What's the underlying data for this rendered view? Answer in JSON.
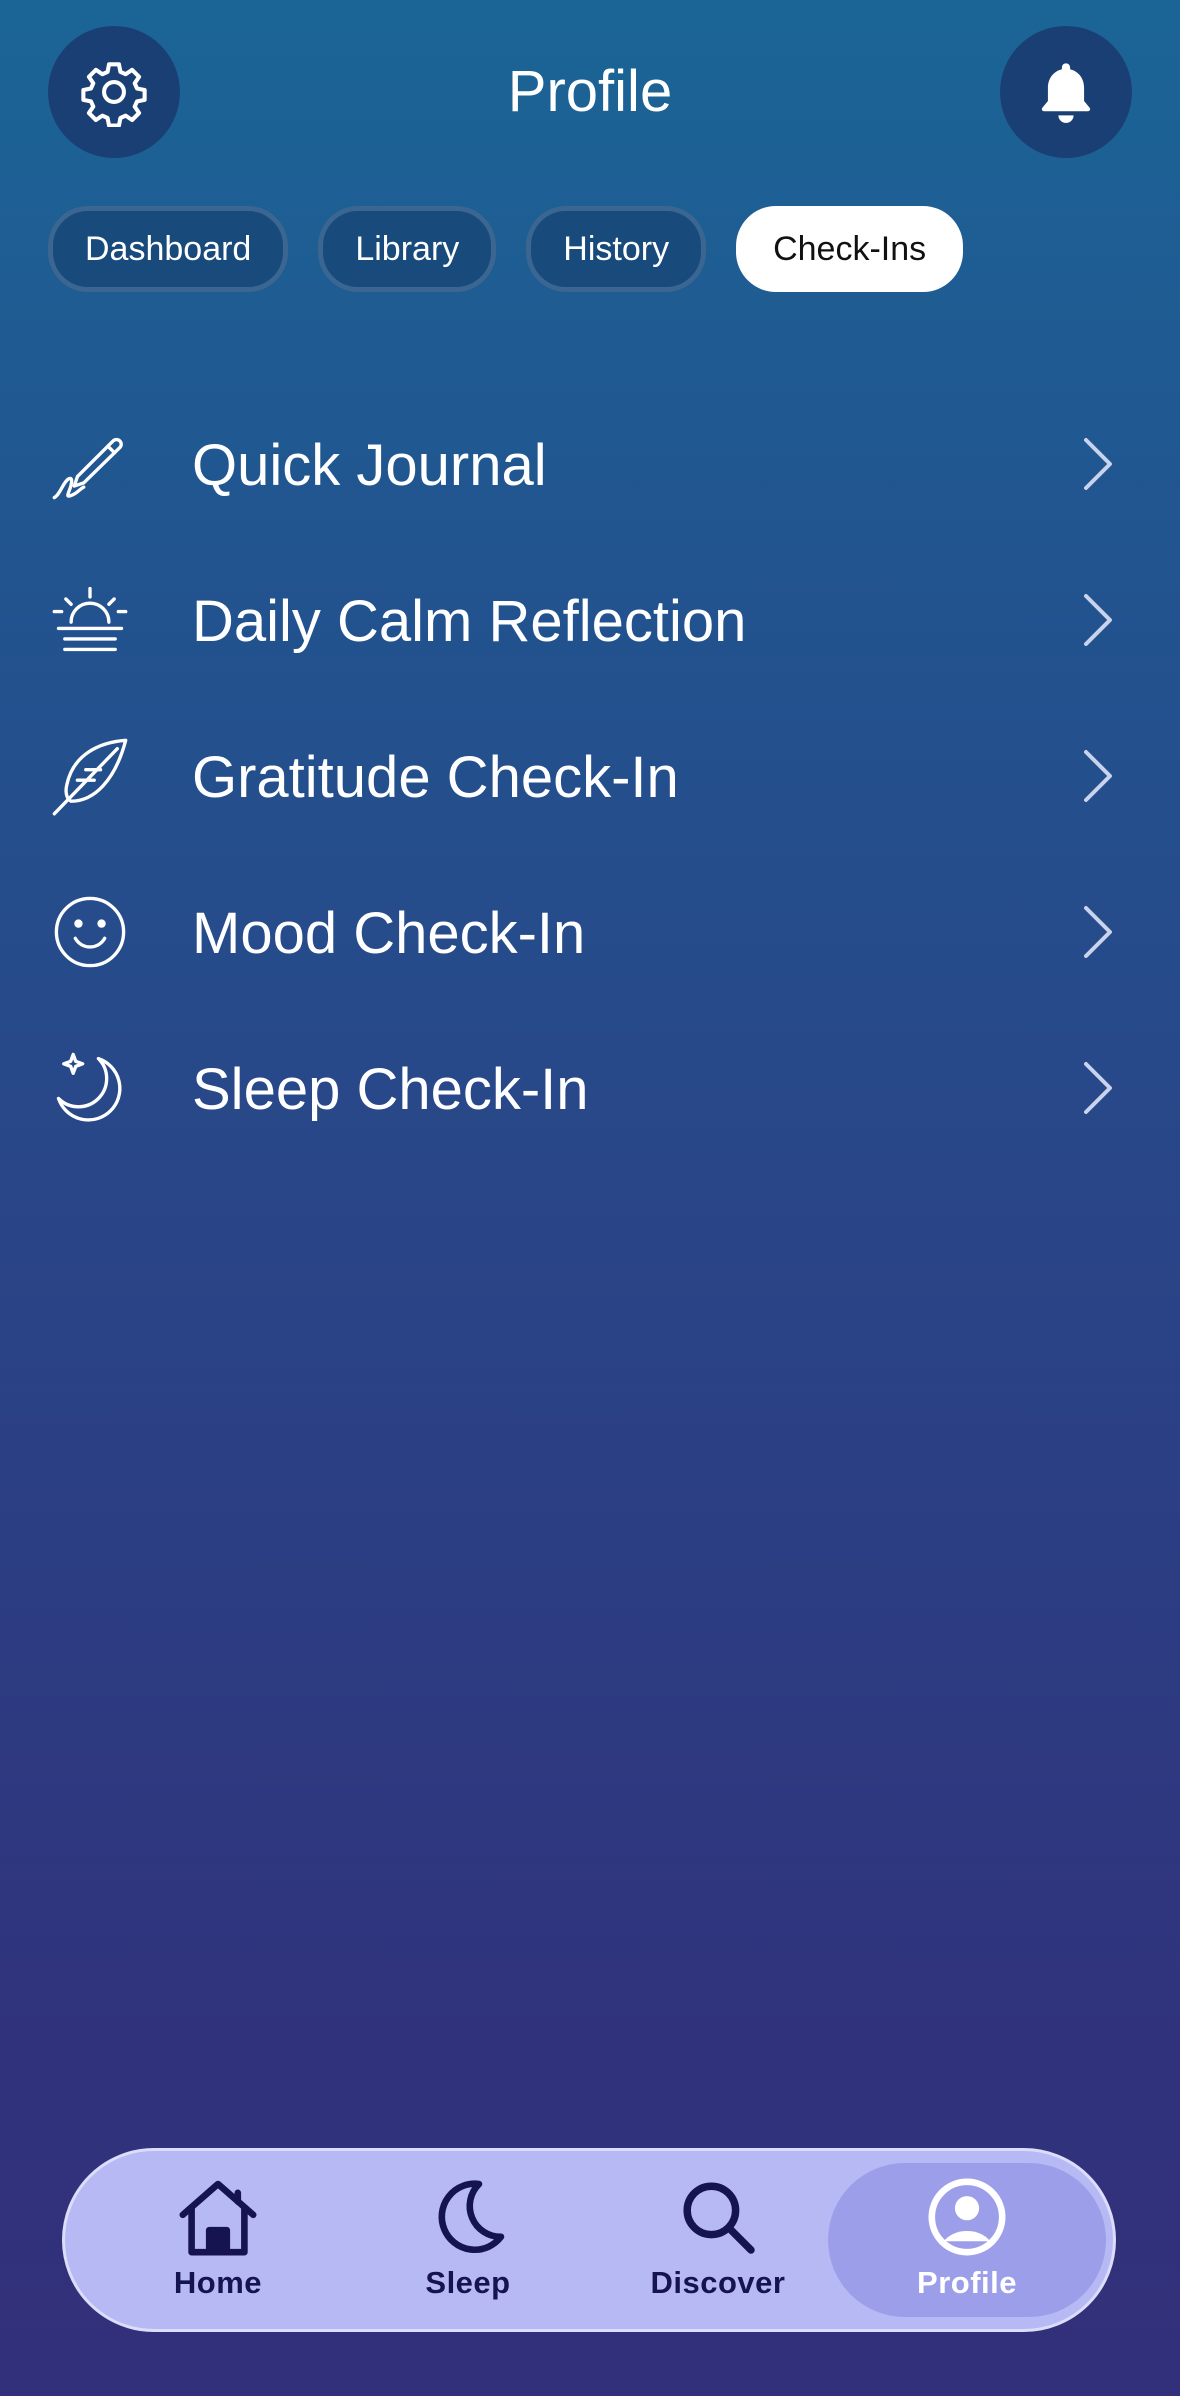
{
  "header": {
    "title": "Profile",
    "left_icon": "gear-icon",
    "right_icon": "bell-icon"
  },
  "tabs": [
    {
      "label": "Dashboard",
      "active": false
    },
    {
      "label": "Library",
      "active": false
    },
    {
      "label": "History",
      "active": false
    },
    {
      "label": "Check-Ins",
      "active": true
    }
  ],
  "check_ins": [
    {
      "label": "Quick Journal",
      "icon": "pencil-icon"
    },
    {
      "label": "Daily Calm Reflection",
      "icon": "sunrise-icon"
    },
    {
      "label": "Gratitude Check-In",
      "icon": "feather-icon"
    },
    {
      "label": "Mood Check-In",
      "icon": "smiley-icon"
    },
    {
      "label": "Sleep Check-In",
      "icon": "moon-sparkle-icon"
    }
  ],
  "bottom_nav": [
    {
      "label": "Home",
      "icon": "home-icon",
      "active": false
    },
    {
      "label": "Sleep",
      "icon": "moon-icon",
      "active": false
    },
    {
      "label": "Discover",
      "icon": "search-icon",
      "active": false
    },
    {
      "label": "Profile",
      "icon": "user-icon",
      "active": true
    }
  ],
  "colors": {
    "background_top": "#1b6596",
    "background_bottom": "#32307a",
    "nav_bar": "#b7b9f5",
    "nav_active": "#9c9eea",
    "tab_active": "#ffffff"
  }
}
